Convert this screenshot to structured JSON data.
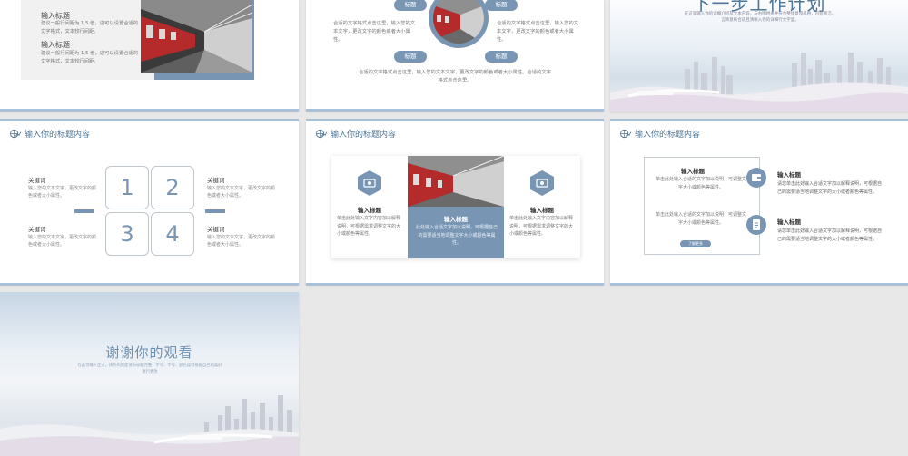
{
  "colors": {
    "accent": "#7896b4",
    "accent_dark": "#4e7696",
    "rail": "#aac2d8"
  },
  "header_icon": "globe-chart-icon",
  "slide1": {
    "items": [
      {
        "title": "输入标题",
        "desc": "建议一般行间距为 1.5 倍，这可以设置合适的文字格式，文本较行间距。"
      },
      {
        "title": "输入标题",
        "desc": "建议一般行间距为 1.5 倍，这可以设置合适的文字格式，文本较行间距。"
      }
    ]
  },
  "slide2": {
    "pills": [
      "标题",
      "标题",
      "标题",
      "标题"
    ],
    "left_text": "合适的文字格式点击这里，输入您的文本文字，更改文字的颜色或者大小属性。",
    "right_text": "合适的文字格式点击这里，输入您的文本文字，更改文字的颜色或者大小属性。",
    "bottom_text": "合适的文字格式点击这里，输入您的文本文字，更改文字的颜色或者大小属性。合适的文字格式点击这里。"
  },
  "slide3": {
    "title": "下一步工作计划",
    "subtitle": "在这里输入你的详细介绍及文本内容，与右图相关并符合整体意境风格，内容简洁、言简意赅合适且清晰入你的详细行文字里。"
  },
  "slide4": {
    "header": "输入你的标题内容",
    "numbers": [
      "1",
      "2",
      "3",
      "4"
    ],
    "keywords": [
      {
        "title": "关键词",
        "desc": "输入您的文本文字，更改文字的颜色或者大小属性。"
      },
      {
        "title": "关键词",
        "desc": "输入您的文本文字，更改文字的颜色或者大小属性。"
      },
      {
        "title": "关键词",
        "desc": "输入您的文本文字，更改文字的颜色或者大小属性。"
      },
      {
        "title": "关键词",
        "desc": "输入您的文本文字，更改文字的颜色或者大小属性。"
      }
    ]
  },
  "slide5": {
    "header": "输入你的标题内容",
    "left": {
      "title": "输入标题",
      "desc": "单击此处输入文字内容加以解释说明，可根据需求调整文字的大小或颜色等属性。"
    },
    "middle": {
      "title": "输入标题",
      "desc": "此处输入合适文字加以说明，可根据自己的需要适当地调整文字大小或颜色等属性。"
    },
    "right": {
      "title": "输入标题",
      "desc": "单击此处输入文字内容加以解释说明，可根据需求调整文字的大小或颜色等属性。"
    }
  },
  "slide6": {
    "header": "输入你的标题内容",
    "frame_items": [
      {
        "title": "输入标题",
        "desc": "单击此处输入合适的文字加以说明，可调整文字大小或颜色等属性。"
      },
      {
        "desc": "单击此处输入合适的文字加以说明，可调整文字大小或颜色等属性。"
      }
    ],
    "button": "了解更多",
    "right_items": [
      {
        "title": "输入标题",
        "desc": "请您单击此处输入合适文字加以解释说明，可根据自己的需要适当地调整文字的大小或者颜色等属性。",
        "icon": "wallet-icon"
      },
      {
        "title": "输入标题",
        "desc": "请您单击此处输入合适文字加以解释说明，可根据自己的需要适当地调整文字的大小或者颜色等属性。",
        "icon": "document-icon"
      }
    ]
  },
  "slide7": {
    "title": "谢谢你的观看",
    "subtitle": "在此可输入正文，请务向我是请你标题完整，字号、字号、颜色设可根据自己的喜好进行更改"
  }
}
